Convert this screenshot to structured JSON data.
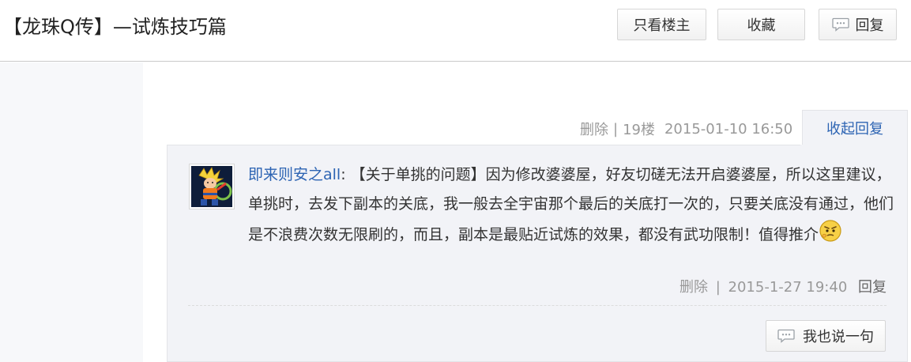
{
  "header": {
    "title": "【龙珠Q传】—试炼技巧篇",
    "only_op_label": "只看楼主",
    "favorite_label": "收藏",
    "reply_label": "回复"
  },
  "floor": {
    "delete_label": "删除",
    "separator": "|",
    "floor_number": "19楼",
    "timestamp": "2015-01-10 16:50",
    "collapse_label": "收起回复"
  },
  "sub_reply": {
    "username": "即来则安之all",
    "colon": ":",
    "text": "【关于单挑的问题】因为修改婆婆屋，好友切磋无法开启婆婆屋，所以这里建议，单挑时，去发下副本的关底，我一般去全宇宙那个最后的关底打一次的，只要关底没有通过，他们是不浪费次数无限刷的，而且，副本是最贴近试炼的效果，都没有武功限制！值得推介",
    "delete_label": "删除",
    "separator": "|",
    "timestamp": "2015-1-27 19:40",
    "reply_label": "回复"
  },
  "say_button_label": "我也说一句",
  "icons": {
    "chat": "chat-bubble-icon",
    "emoji": "thinking-face-emoji",
    "avatar": "user-avatar-goku"
  },
  "colors": {
    "link_blue": "#2d64b3",
    "meta_gray": "#999999",
    "box_bg": "#f2f3f7"
  }
}
